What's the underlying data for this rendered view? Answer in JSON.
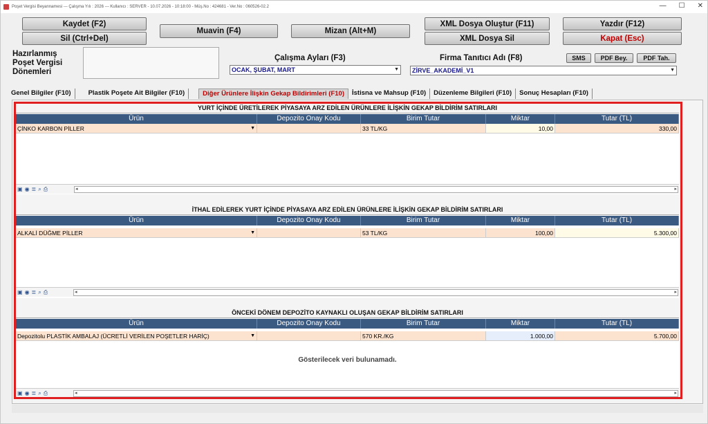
{
  "window": {
    "title": "Poşet Vergisi Beyannamesi  ---  Çalışma Yılı : 2026  ---  Kullanıcı : SERVER - 10.07.2026 - 10:18:00 - Müş.No : 424681 - Ver.No : 060526-02.2",
    "minimize": "—",
    "maximize": "☐",
    "close": "✕"
  },
  "buttons": {
    "kaydet": "Kaydet (F2)",
    "sil": "Sil (Ctrl+Del)",
    "muavin": "Muavin (F4)",
    "mizan": "Mizan (Alt+M)",
    "xml_olustur": "XML Dosya Oluştur (F11)",
    "xml_sil": "XML Dosya Sil",
    "yazdir": "Yazdır (F12)",
    "kapat": "Kapat (Esc)",
    "sms": "SMS",
    "pdf_bey": "PDF Bey.",
    "pdf_tah": "PDF Tah."
  },
  "labels": {
    "hazirlanmis_1": "Hazırlanmış",
    "hazirlanmis_2": "Poşet Vergisi",
    "hazirlanmis_3": "Dönemleri",
    "calisma_aylari": "Çalışma Ayları (F3)",
    "firma_tanitici": "Firma Tanıtıcı Adı (F8)"
  },
  "selects": {
    "calisma_aylari_value": "OCAK, ŞUBAT, MART",
    "firma_value": "ZİRVE_AKADEMİ_V1"
  },
  "tabs": [
    {
      "label": "Genel Bilgiler (F10)"
    },
    {
      "label": "Plastik Poşete Ait Bilgiler (F10)"
    },
    {
      "label": "Diğer Ürünlere İlişkin Gekap Bildirimleri (F10)"
    },
    {
      "label": "İstisna ve Mahsup (F10)"
    },
    {
      "label": "Düzenleme Bilgileri (F10)"
    },
    {
      "label": "Sonuç Hesapları (F10)"
    }
  ],
  "columns": {
    "urun": "Ürün",
    "depozito": "Depozito Onay Kodu",
    "birim": "Birim Tutar",
    "miktar": "Miktar",
    "tutar": "Tutar (TL)"
  },
  "sections": [
    {
      "title": "YURT İÇİNDE ÜRETİLEREK PİYASAYA ARZ EDİLEN ÜRÜNLERE İLİŞKİN GEKAP BİLDİRİM SATIRLARI",
      "row": {
        "urun": "ÇİNKO KARBON PİLLER",
        "depozito": "",
        "birim": "33 TL/KG",
        "miktar": "10,00",
        "tutar": "330,00"
      }
    },
    {
      "title": "İTHAL EDİLEREK YURT İÇİNDE PİYASAYA ARZ EDİLEN ÜRÜNLERE İLİŞKİN GEKAP BİLDİRİM SATIRLARI",
      "row": {
        "urun": "ALKALİ DÜĞME PİLLER",
        "depozito": "",
        "birim": "53 TL/KG",
        "miktar": "100,00",
        "tutar": "5.300,00"
      }
    },
    {
      "title": "ÖNCEKİ DÖNEM DEPOZİTO KAYNAKLI OLUŞAN GEKAP BİLDİRİM SATIRLARI",
      "row": {
        "urun": "Depozitolu PLASTİK AMBALAJ (ÜCRETLİ VERİLEN POŞETLER HARİÇ)",
        "depozito": "",
        "birim": "570 KR./KG",
        "miktar": "1.000,00",
        "tutar": "5.700,00"
      },
      "empty_message": "Gösterilecek veri bulunamadı."
    }
  ],
  "toolbar_icons": [
    "save-icon",
    "view-icon",
    "list-icon",
    "search-icon",
    "print-icon"
  ],
  "colors": {
    "grid_header": "#3b5a82",
    "row_peach": "#fbe3d0",
    "highlight": "#e02020",
    "active_tab_text": "#c00000"
  }
}
